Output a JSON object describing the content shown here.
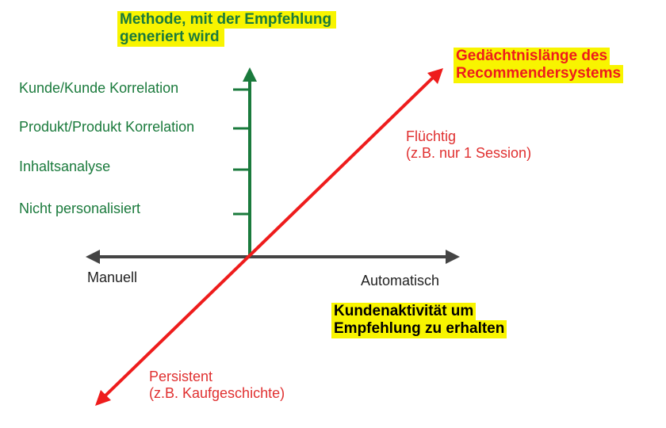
{
  "y_axis": {
    "title_line1": "Methode, mit der Empfehlung",
    "title_line2": "generiert wird",
    "color": "#1a7a3c",
    "levels": [
      "Kunde/Kunde Korrelation",
      "Produkt/Produkt Korrelation",
      "Inhaltsanalyse",
      "Nicht personalisiert"
    ]
  },
  "x_axis": {
    "left_label": "Manuell",
    "right_label": "Automatisch",
    "title_line1": "Kundenaktivität um",
    "title_line2": "Empfehlung zu erhalten",
    "color": "#444444"
  },
  "z_axis": {
    "title_line1": "Gedächtnislänge des",
    "title_line2": "Recommendersystems",
    "upper_line1": "Flüchtig",
    "upper_line2": "(z.B. nur 1 Session)",
    "lower_line1": "Persistent",
    "lower_line2": "(z.B. Kaufgeschichte)",
    "color": "#ee1c1c"
  },
  "highlight_color": "#f8f400"
}
